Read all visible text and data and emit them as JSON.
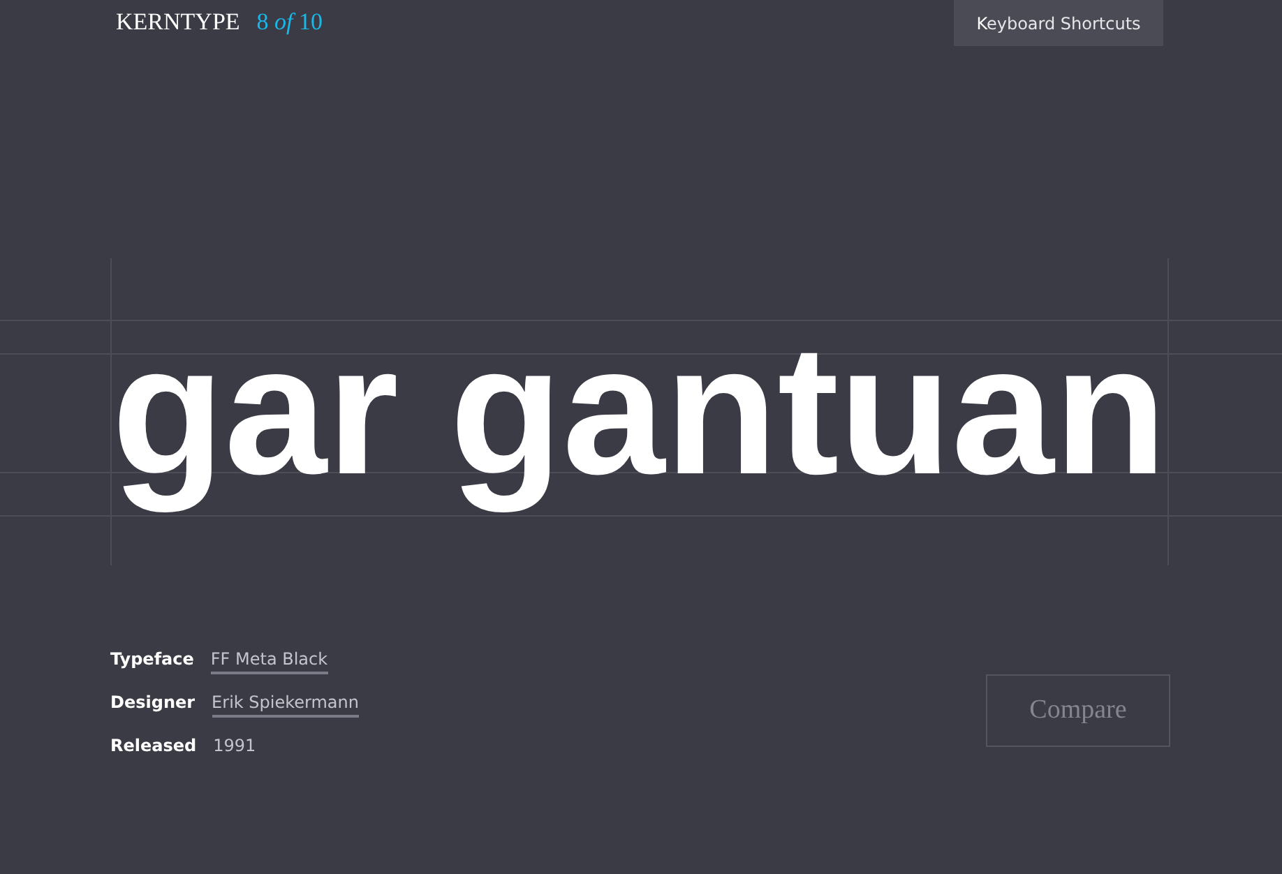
{
  "header": {
    "title": "KERNTYPE",
    "progress": "8 *of* 10",
    "shortcuts_button": "Keyboard Shortcuts"
  },
  "specimen": {
    "word": "gar gantuan"
  },
  "details": [
    {
      "label": "Typeface",
      "value": "FF Meta Black",
      "kind": "link"
    },
    {
      "label": "Designer",
      "value": "Erik Spiekermann",
      "kind": "link"
    },
    {
      "label": "Released",
      "value": "1991",
      "kind": "text"
    }
  ],
  "compare_button": "Compare"
}
